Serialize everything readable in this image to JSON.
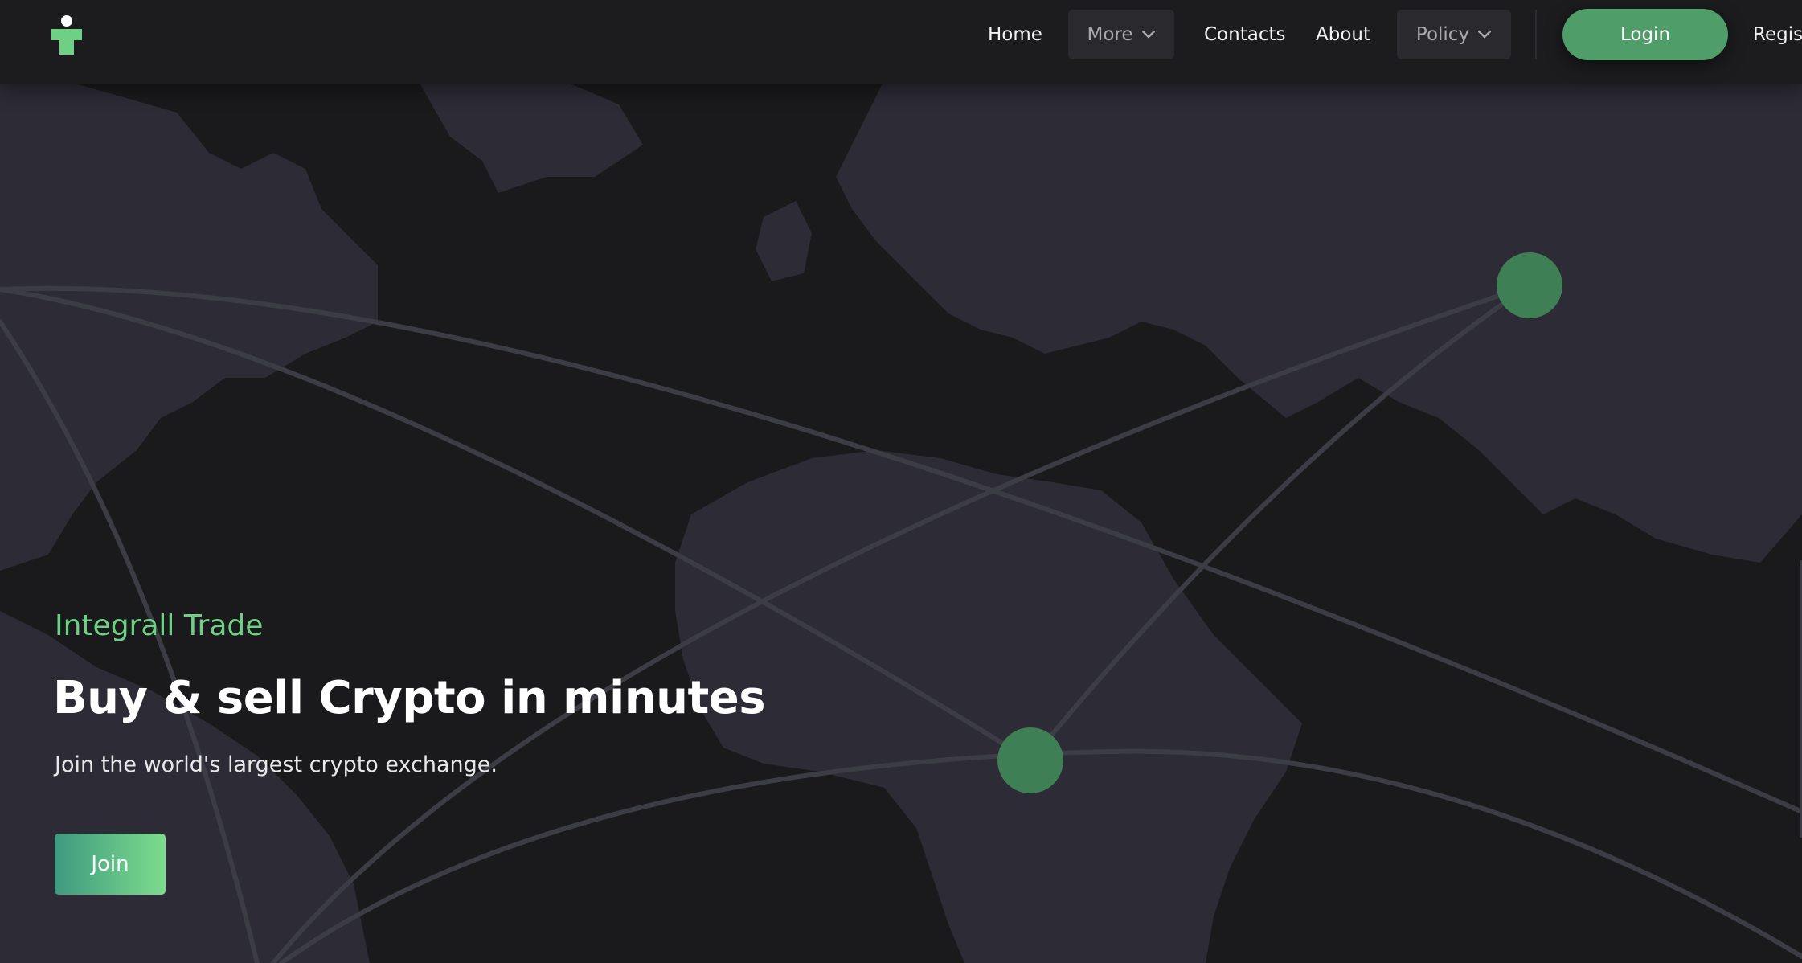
{
  "colors": {
    "page_bg": "#1a1a1c",
    "land": "#2c2b36",
    "accent": "#4f9e6a",
    "brand_green": "#6fcf84",
    "node": "#3f7f55"
  },
  "header": {
    "logo_icon": "person-logo-icon",
    "nav": {
      "home": "Home",
      "more": "More",
      "contacts": "Contacts",
      "about": "About",
      "policy": "Policy"
    },
    "login_label": "Login",
    "register_label": "Regist"
  },
  "hero": {
    "brand": "Integrall Trade",
    "title": "Buy & sell Crypto in minutes",
    "subtitle": "Join the world's largest crypto exchange.",
    "join_label": "Join"
  }
}
